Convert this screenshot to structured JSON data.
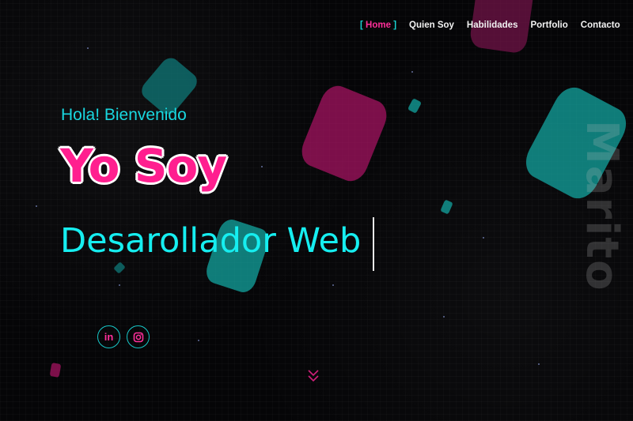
{
  "nav": {
    "items": [
      {
        "label": "Home",
        "active": true
      },
      {
        "label": "Quien Soy",
        "active": false
      },
      {
        "label": "Habilidades",
        "active": false
      },
      {
        "label": "Portfolio",
        "active": false
      },
      {
        "label": "Contacto",
        "active": false
      }
    ],
    "bracket_open": "[",
    "bracket_close": "]"
  },
  "hero": {
    "greeting": "Hola! Bienvenido",
    "headline": "Yo Soy",
    "role": "Desarollador Web",
    "vertical_name": "Marito"
  },
  "social": {
    "linkedin_label": "in",
    "instagram_icon": "instagram-icon"
  },
  "colors": {
    "accent_pink": "#ff1f8f",
    "accent_cyan": "#16eef0",
    "background": "#050507"
  },
  "icons": [
    "linkedin-icon",
    "instagram-icon",
    "chevron-double-down-icon"
  ]
}
